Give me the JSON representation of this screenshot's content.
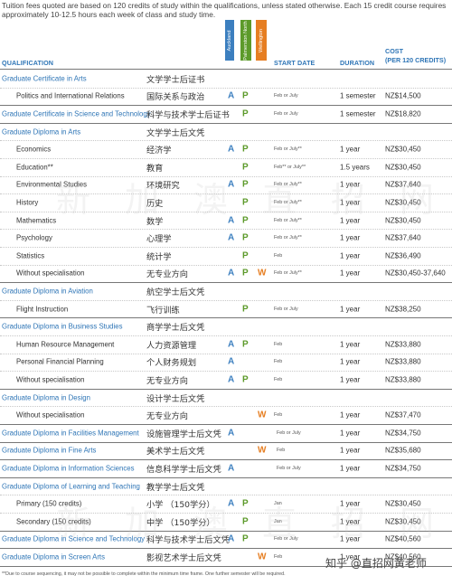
{
  "intro": "Tuition fees quoted are based on 120 credits of study within the qualifications, unless stated otherwise. Each 15 credit course requires approximately 10-12.5 hours each week of class and study time.",
  "campuses": {
    "auckland": "Auckland",
    "palmerston": "Palmerston North",
    "wellington": "Wellington"
  },
  "headers": {
    "qualification": "QUALIFICATION",
    "start_date": "START DATE",
    "duration": "DURATION",
    "cost_line1": "COST",
    "cost_line2": "(PER 120 CREDITS)"
  },
  "rows": [
    {
      "en": "Graduate Certificate in Arts",
      "cn": "文学学士后证书",
      "cat": true
    },
    {
      "en": "Politics and International Relations",
      "cn": "国际关系与政治",
      "a": "A",
      "p": "P",
      "start": "Feb or July",
      "dur": "1 semester",
      "cost": "NZ$14,500"
    },
    {
      "en": "Graduate Certificate in Science and Technology",
      "cn": "科学与技术学士后证书",
      "cat": true,
      "p": "P",
      "start": "Feb or July",
      "dur": "1 semester",
      "cost": "NZ$18,820"
    },
    {
      "en": "Graduate Diploma in Arts",
      "cn": "文学学士后文凭",
      "cat": true
    },
    {
      "en": "Economics",
      "cn": "经济学",
      "a": "A",
      "p": "P",
      "start": "Feb or July**",
      "dur": "1 year",
      "cost": "NZ$30,450"
    },
    {
      "en": "Education**",
      "cn": "教育",
      "p": "P",
      "start": "Feb** or July**",
      "dur": "1.5  years",
      "cost": "NZ$30,450"
    },
    {
      "en": "Environmental Studies",
      "cn": "环境研究",
      "a": "A",
      "p": "P",
      "start": "Feb or July**",
      "dur": "1 year",
      "cost": "NZ$37,640"
    },
    {
      "en": "History",
      "cn": "历史",
      "p": "P",
      "start": "Feb or July**",
      "dur": "1 year",
      "cost": "NZ$30,450"
    },
    {
      "en": "Mathematics",
      "cn": "数学",
      "a": "A",
      "p": "P",
      "start": "Feb or July**",
      "dur": "1 year",
      "cost": "NZ$30,450"
    },
    {
      "en": "Psychology",
      "cn": "心理学",
      "a": "A",
      "p": "P",
      "start": "Feb or July**",
      "dur": "1 year",
      "cost": "NZ$37,640"
    },
    {
      "en": "Statistics",
      "cn": "统计学",
      "p": "P",
      "start": "Feb",
      "dur": "1 year",
      "cost": "NZ$36,490"
    },
    {
      "en": "Without specialisation",
      "cn": "无专业方向",
      "a": "A",
      "p": "P",
      "w": "W",
      "start": "Feb or July**",
      "dur": "1 year",
      "cost": "NZ$30,450-37,640"
    },
    {
      "en": "Graduate Diploma in Aviation",
      "cn": "航空学士后文凭",
      "cat": true
    },
    {
      "en": "Flight Instruction",
      "cn": "飞行训练",
      "p": "P",
      "start": "Feb or July",
      "dur": "1 year",
      "cost": "NZ$38,250"
    },
    {
      "en": "Graduate Diploma in Business Studies",
      "cn": "商学学士后文凭",
      "cat": true
    },
    {
      "en": "Human Resource Management",
      "cn": "人力资源管理",
      "a": "A",
      "p": "P",
      "start": "Feb",
      "dur": "1 year",
      "cost": "NZ$33,880"
    },
    {
      "en": "Personal Financial Planning",
      "cn": "个人财务规划",
      "a": "A",
      "start": "Feb",
      "dur": "1 year",
      "cost": "NZ$33,880"
    },
    {
      "en": "Without specialisation",
      "cn": "无专业方向",
      "a": "A",
      "p": "P",
      "start": "Feb",
      "dur": "1 year",
      "cost": "NZ$33,880"
    },
    {
      "en": "Graduate Diploma in Design",
      "cn": "设计学士后文凭",
      "cat": true
    },
    {
      "en": "Without specialisation",
      "cn": "无专业方向",
      "w": "W",
      "start": "Feb",
      "dur": "1 year",
      "cost": "NZ$37,470"
    },
    {
      "en": "Graduate Diploma in Facilities Management",
      "cn": "设施管理学士后文凭",
      "cat": true,
      "a": "A",
      "start": "Feb or July",
      "start_wide": true,
      "dur": "1 year",
      "cost": "NZ$34,750"
    },
    {
      "en": "Graduate Diploma in Fine Arts",
      "cn": "美术学士后文凭",
      "cat": true,
      "w": "W",
      "start": "Feb",
      "start_wide": true,
      "dur": "1 year",
      "cost": "NZ$35,680"
    },
    {
      "en": "Graduate Diploma in Information Sciences",
      "cn": "信息科学学士后文凭",
      "cat": true,
      "a": "A",
      "start": "Feb or July",
      "start_wide": true,
      "dur": "1 year",
      "cost": "NZ$34,750"
    },
    {
      "en": "Graduate Diploma of Learning and Teaching",
      "cn": "教学学士后文凭",
      "cat": true
    },
    {
      "en": "Primary (150 credits)",
      "cn": "小学 （150学分）",
      "a": "A",
      "p": "P",
      "start": "Jan",
      "dur": "1 year",
      "cost": "NZ$30,450"
    },
    {
      "en": "Secondary (150 credits)",
      "cn": "中学 （150学分）",
      "p": "P",
      "start": "Jan",
      "dur": "1 year",
      "cost": "NZ$30,450"
    },
    {
      "en": "Graduate Diploma in Science and Technology",
      "cn": "科学与技术学士后文凭",
      "cat": true,
      "a": "A",
      "p": "P",
      "start": "Feb or July",
      "dur": "1 year",
      "cost": "NZ$40,560"
    },
    {
      "en": "Graduate Diploma in Screen Arts",
      "cn": "影视艺术学士后文凭",
      "cat": true,
      "w": "W",
      "start": "Feb",
      "dur": "1 year",
      "cost": "NZ$40,560"
    }
  ],
  "watermark1": "新加澳直招网",
  "watermark2": "新加澳直招网",
  "credit": "知乎 @直招网黄老师",
  "footnote": "**Due to course sequencing, it may not be possible to complete within the minimum time frame. One further semester will be required."
}
